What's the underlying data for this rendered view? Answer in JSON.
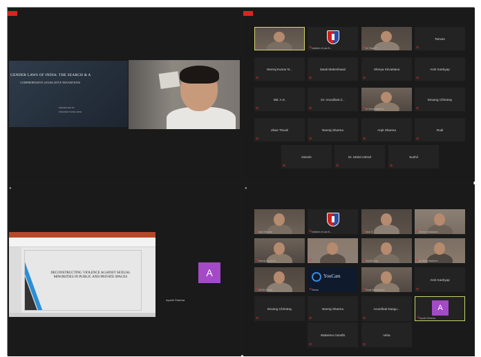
{
  "q1": {
    "slide_title": "GENDER LAWS OF INDIA: THE SEARCH & A",
    "slide_subtitle": "COMPREHENSIVE LEGISLATIVE TRANSITIONS",
    "slide_line1": "PRESENTED BY",
    "slide_line2": "SPEAKER NAME HERE"
  },
  "q2": {
    "tiles": [
      {
        "label": "",
        "caption": "",
        "kind": "video"
      },
      {
        "label": "",
        "caption": "Institute of Law N...",
        "kind": "logo"
      },
      {
        "label": "",
        "caption": "Dr. Rajat P...",
        "kind": "video"
      },
      {
        "label": "Tanvee",
        "caption": "",
        "kind": "name"
      },
      {
        "label": "Neeraj Kumar N...",
        "caption": "",
        "kind": "name"
      },
      {
        "label": "Swati Maheshwari",
        "caption": "",
        "kind": "name"
      },
      {
        "label": "Shreya Srivastava",
        "caption": "",
        "kind": "name"
      },
      {
        "label": "Amit Kashyap",
        "caption": "",
        "kind": "name"
      },
      {
        "label": "Md. A.S.",
        "caption": "",
        "kind": "name"
      },
      {
        "label": "Dr. Arundhati d...",
        "caption": "",
        "kind": "name"
      },
      {
        "label": "",
        "caption": "Dr Mohd Nadeem",
        "kind": "video"
      },
      {
        "label": "Devang Chhotray",
        "caption": "",
        "kind": "name"
      },
      {
        "label": "Vikas Trivedi",
        "caption": "",
        "kind": "name"
      },
      {
        "label": "Neeraj Sharma",
        "caption": "",
        "kind": "name"
      },
      {
        "label": "Arpit Sharma",
        "caption": "",
        "kind": "name"
      },
      {
        "label": "Rudi",
        "caption": "",
        "kind": "name"
      },
      {
        "label": "Dinesh",
        "caption": "",
        "kind": "name"
      },
      {
        "label": "Dr. Mohd Ashraf",
        "caption": "",
        "kind": "name"
      },
      {
        "label": "Sushil",
        "caption": "",
        "kind": "name"
      }
    ]
  },
  "q3": {
    "slide_text": "DECONSTRUCTING VIOLENCE AGAINST SEXUAL MINORITIES IN PUBLIC AND PRIVATE SPACES",
    "avatar_letter": "A",
    "avatar_name": "Ayushi Sharma"
  },
  "q4": {
    "tiles": [
      {
        "label": "",
        "caption": "Arpit Sharma",
        "kind": "video"
      },
      {
        "label": "",
        "caption": "Institute of Law N...",
        "kind": "logo"
      },
      {
        "label": "",
        "caption": "Arun S.",
        "kind": "video"
      },
      {
        "label": "",
        "caption": "Shreya Srivastava",
        "kind": "video"
      },
      {
        "label": "",
        "caption": "Neeraj Kumar N...",
        "kind": "video"
      },
      {
        "label": "",
        "caption": "",
        "kind": "video"
      },
      {
        "label": "",
        "caption": "Sukriti Garg",
        "kind": "video"
      },
      {
        "label": "",
        "caption": "Dr. Mohd Nadeem",
        "kind": "video"
      },
      {
        "label": "",
        "caption": "ARUN Kumar",
        "kind": "video"
      },
      {
        "label": "",
        "caption": "Sahaa",
        "kind": "logo2"
      },
      {
        "label": "",
        "caption": "Swati Maheshwari",
        "kind": "video"
      },
      {
        "label": "Amit Kashyap",
        "caption": "",
        "kind": "name"
      },
      {
        "label": "Devang Chhotray",
        "caption": "",
        "kind": "name"
      },
      {
        "label": "Neeraj Sharma",
        "caption": "",
        "kind": "name"
      },
      {
        "label": "Arundhati Dasgu...",
        "caption": "",
        "kind": "name"
      },
      {
        "label": "",
        "caption": "Ayushi Sharma",
        "kind": "avatar"
      },
      {
        "label": "Wakeima Gandhi",
        "caption": "",
        "kind": "name"
      },
      {
        "label": "neha",
        "caption": "",
        "kind": "name"
      }
    ],
    "logo2_text": "YouCam",
    "avatar_letter": "A"
  },
  "colors": {
    "avatar": "#a44ac7",
    "active_border": "#d7d86a",
    "record": "#d22222"
  },
  "icons": [
    "mic-muted-icon"
  ]
}
